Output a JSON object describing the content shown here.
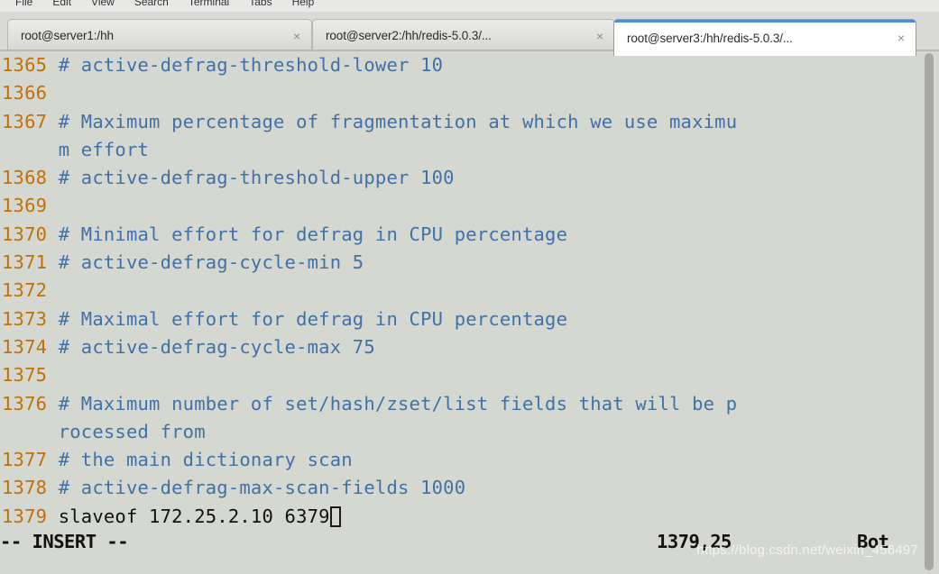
{
  "window": {
    "app": "gnome-terminal",
    "background_color": "#d4d8d0"
  },
  "menubar": {
    "items": [
      {
        "label": "File"
      },
      {
        "label": "Edit"
      },
      {
        "label": "View"
      },
      {
        "label": "Search"
      },
      {
        "label": "Terminal"
      },
      {
        "label": "Tabs"
      },
      {
        "label": "Help"
      }
    ]
  },
  "tabs": {
    "active_index": 2,
    "close_glyph": "×",
    "items": [
      {
        "label": "root@server1:/hh",
        "active": false
      },
      {
        "label": "root@server2:/hh/redis-5.0.3/...",
        "active": false
      },
      {
        "label": "root@server3:/hh/redis-5.0.3/...",
        "active": true
      }
    ]
  },
  "editor": {
    "colors": {
      "background": "#d4d8d0",
      "line_number": "#c2700a",
      "comment": "#4071a8",
      "text": "#111111"
    },
    "lines": [
      {
        "num": "1365",
        "text": "# active-defrag-threshold-lower 10",
        "kind": "comment"
      },
      {
        "num": "1366",
        "text": "",
        "kind": "comment"
      },
      {
        "num": "1367",
        "text": "# Maximum percentage of fragmentation at which we use maximu",
        "kind": "comment"
      },
      {
        "num": "",
        "text": "m effort",
        "kind": "comment",
        "wrapped": true
      },
      {
        "num": "1368",
        "text": "# active-defrag-threshold-upper 100",
        "kind": "comment"
      },
      {
        "num": "1369",
        "text": "",
        "kind": "comment"
      },
      {
        "num": "1370",
        "text": "# Minimal effort for defrag in CPU percentage",
        "kind": "comment"
      },
      {
        "num": "1371",
        "text": "# active-defrag-cycle-min 5",
        "kind": "comment"
      },
      {
        "num": "1372",
        "text": "",
        "kind": "comment"
      },
      {
        "num": "1373",
        "text": "# Maximal effort for defrag in CPU percentage",
        "kind": "comment"
      },
      {
        "num": "1374",
        "text": "# active-defrag-cycle-max 75",
        "kind": "comment"
      },
      {
        "num": "1375",
        "text": "",
        "kind": "comment"
      },
      {
        "num": "1376",
        "text": "# Maximum number of set/hash/zset/list fields that will be p",
        "kind": "comment"
      },
      {
        "num": "",
        "text": "rocessed from",
        "kind": "comment",
        "wrapped": true
      },
      {
        "num": "1377",
        "text": "# the main dictionary scan",
        "kind": "comment"
      },
      {
        "num": "1378",
        "text": "# active-defrag-max-scan-fields 1000",
        "kind": "comment"
      },
      {
        "num": "1379",
        "text": "slaveof 172.25.2.10 6379",
        "kind": "plain",
        "cursor": true
      }
    ]
  },
  "statusline": {
    "mode": "-- INSERT --",
    "ruler": "1379,25",
    "position": "Bot"
  },
  "watermark": {
    "text": "https://blog.csdn.net/weixin_45649763"
  }
}
